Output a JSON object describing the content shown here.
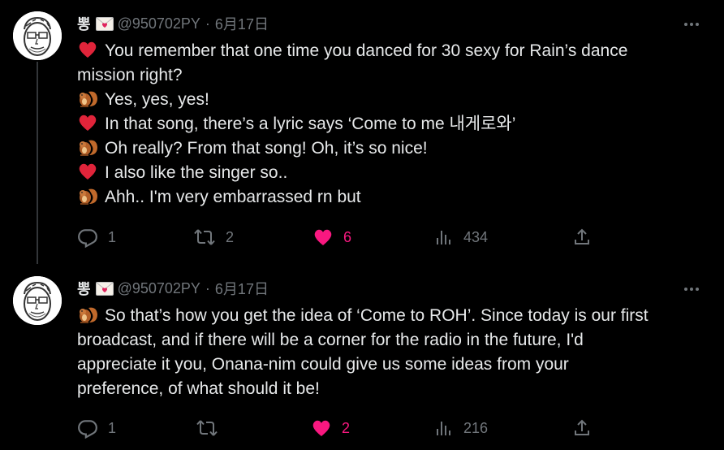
{
  "tweets": [
    {
      "name": "뽕",
      "handle": "@950702PY",
      "separator": "·",
      "date": "6月17日",
      "lines": [
        {
          "emoji": "heart",
          "text": "You remember that one time you danced for 30 sexy for Rain’s dance"
        },
        {
          "emoji": "",
          "text": "mission right?"
        },
        {
          "emoji": "chipmunk",
          "text": "Yes, yes, yes!"
        },
        {
          "emoji": "heart",
          "text": "In that song, there’s a lyric says ‘Come to me 내게로와’"
        },
        {
          "emoji": "chipmunk",
          "text": "Oh really? From that song! Oh, it’s so nice!"
        },
        {
          "emoji": "heart",
          "text": "I also like the singer so.."
        },
        {
          "emoji": "chipmunk",
          "text": "Ahh.. I'm very embarrassed rn but"
        }
      ],
      "replies": "1",
      "retweets": "2",
      "likes": "6",
      "views": "434"
    },
    {
      "name": "뽕",
      "handle": "@950702PY",
      "separator": "·",
      "date": "6月17日",
      "lines": [
        {
          "emoji": "chipmunk",
          "text": "So that’s how you get the idea of ‘Come to ROH’. Since today is our first"
        },
        {
          "emoji": "",
          "text": "broadcast, and if there will be a corner for the radio in the future, I'd"
        },
        {
          "emoji": "",
          "text": "appreciate it you, Onana-nim could give us some ideas from your"
        },
        {
          "emoji": "",
          "text": "preference, of what should it be!"
        }
      ],
      "replies": "1",
      "retweets": "",
      "likes": "2",
      "views": "216"
    }
  ],
  "colors": {
    "background": "#000000",
    "text": "#e7e9ea",
    "muted": "#71767b",
    "like": "#f91880",
    "thread_line": "#333639"
  }
}
